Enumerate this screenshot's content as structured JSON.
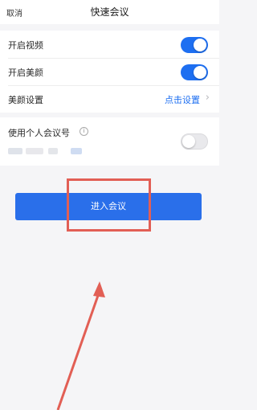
{
  "header": {
    "cancel_label": "取消",
    "title": "快速会议"
  },
  "settings": {
    "video": {
      "label": "开启视频",
      "on": true
    },
    "beauty": {
      "label": "开启美颜",
      "on": true
    },
    "beauty_settings": {
      "label": "美颜设置",
      "link": "点击设置"
    }
  },
  "personal": {
    "label": "使用个人会议号",
    "on": false
  },
  "enter_button": {
    "label": "进入会议",
    "color": "#2a6fea"
  },
  "colors": {
    "accent": "#1e6ff1",
    "annotation": "#e25f55"
  }
}
